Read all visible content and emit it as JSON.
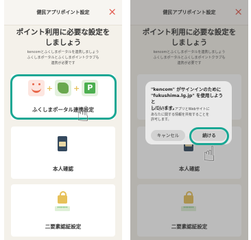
{
  "colors": {
    "accent": "#19a794",
    "close": "#e2574c",
    "background": "#f4f1ea"
  },
  "screens": [
    {
      "header_title": "健民アプリポイント設定",
      "close_icon": "×",
      "main_title": "ポイント利用に必要な設定を\nしましょう",
      "sub_text": "kencomとふくしまポータルを連携しましょう\nふくしまポータルとふくしまポイントクラブも\n連携が必要です",
      "cards": [
        {
          "label": "ふくしまポータル連携設定",
          "icon": "kencom-fukushima-point-logos"
        },
        {
          "label": "本人確認",
          "icon": "phone-id-card-icon"
        },
        {
          "label": "二要素認証設定",
          "icon": "lock-password-icon"
        }
      ],
      "pw_mask": "******",
      "logos_plus": "+",
      "point_mark": "P"
    },
    {
      "header_title": "健民アプリポイント設定",
      "close_icon": "×",
      "main_title": "ポイント利用に必要な設定を\nしましょう",
      "sub_text": "kencomとふくしまポータルを連携しましょう\nふくしまポータルとふくしまポイントクラブも\n連携が必要です",
      "cards": [
        {
          "label": "本人確認"
        },
        {
          "label": "二要素認証設定"
        }
      ],
      "pw_mask": "******",
      "dialog": {
        "title": "\"kencom\" がサインインのために\n\"fukushima.lg.jp\" を使用しようと\nしています。",
        "message": "これを行うと、アプリとWebサイトに\nあなたに関する情報を共有することを\n許可します。",
        "cancel_label": "キャンセル",
        "continue_label": "続ける"
      }
    }
  ],
  "hand_icon": "☝"
}
